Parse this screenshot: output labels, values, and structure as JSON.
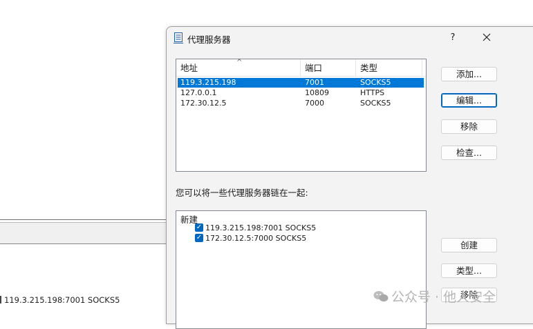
{
  "background": {
    "status_text": "119.3.215.198:7001 SOCKS5"
  },
  "dialog": {
    "title": "代理服务器",
    "help_label": "?",
    "close_label": "✕",
    "icon": "proxy-server-icon",
    "proxy_list": {
      "columns": [
        "地址",
        "端口",
        "类型"
      ],
      "sort_indicator": "^",
      "rows": [
        {
          "address": "119.3.215.198",
          "port": "7001",
          "type": "SOCKS5",
          "selected": true
        },
        {
          "address": "127.0.0.1",
          "port": "10809",
          "type": "HTTPS",
          "selected": false
        },
        {
          "address": "172.30.12.5",
          "port": "7000",
          "type": "SOCKS5",
          "selected": false
        }
      ]
    },
    "buttons": {
      "add": "添加...",
      "edit": "编辑...",
      "remove": "移除",
      "check": "检查..."
    },
    "chain_label": "您可以将一些代理服务器链在一起:",
    "chain": {
      "root": "新建",
      "items": [
        {
          "label": "119.3.215.198:7001 SOCKS5",
          "checked": true
        },
        {
          "label": "172.30.12.5:7000 SOCKS5",
          "checked": true
        }
      ]
    },
    "chain_buttons": {
      "create": "创建",
      "type": "类型...",
      "remove": "移除"
    }
  },
  "watermark": {
    "text": "公众号 · 他人安全",
    "icon": "wechat-icon"
  },
  "colors": {
    "selection": "#0078d7",
    "checkbox": "#0067c0",
    "dialog_bg": "#f3f3f3"
  }
}
